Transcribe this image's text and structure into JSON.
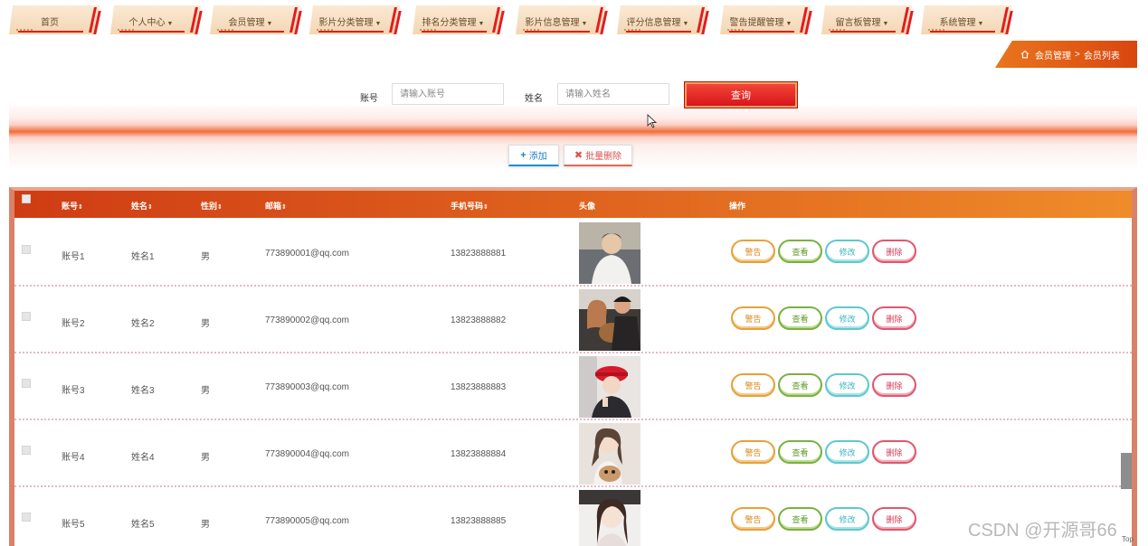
{
  "nav": [
    {
      "label": "首页",
      "dropdown": false
    },
    {
      "label": "个人中心",
      "dropdown": true
    },
    {
      "label": "会员管理",
      "dropdown": true
    },
    {
      "label": "影片分类管理",
      "dropdown": true
    },
    {
      "label": "排名分类管理",
      "dropdown": true
    },
    {
      "label": "影片信息管理",
      "dropdown": true
    },
    {
      "label": "评分信息管理",
      "dropdown": true
    },
    {
      "label": "警告提醒管理",
      "dropdown": true
    },
    {
      "label": "留言板管理",
      "dropdown": true
    },
    {
      "label": "系统管理",
      "dropdown": true
    }
  ],
  "breadcrumb": {
    "first": "会员管理",
    "separator": ">",
    "current": "会员列表"
  },
  "search": {
    "account_label": "账号",
    "account_placeholder": "请输入账号",
    "name_label": "姓名",
    "name_placeholder": "请输入姓名",
    "query_button": "查询"
  },
  "actions": {
    "add": "添加",
    "batch_delete": "批量删除"
  },
  "table": {
    "headers": {
      "account": "账号",
      "name": "姓名",
      "gender": "性别",
      "email": "邮箱",
      "phone": "手机号码",
      "avatar": "头像",
      "ops": "操作"
    },
    "rows": [
      {
        "account": "账号1",
        "name": "姓名1",
        "gender": "男",
        "email": "773890001@qq.com",
        "phone": "13823888881"
      },
      {
        "account": "账号2",
        "name": "姓名2",
        "gender": "男",
        "email": "773890002@qq.com",
        "phone": "13823888882"
      },
      {
        "account": "账号3",
        "name": "姓名3",
        "gender": "男",
        "email": "773890003@qq.com",
        "phone": "13823888883"
      },
      {
        "account": "账号4",
        "name": "姓名4",
        "gender": "男",
        "email": "773890004@qq.com",
        "phone": "13823888884"
      },
      {
        "account": "账号5",
        "name": "姓名5",
        "gender": "男",
        "email": "773890005@qq.com",
        "phone": "13823888885"
      }
    ],
    "row_actions": {
      "warn": "警告",
      "view": "查看",
      "edit": "修改",
      "delete": "删除"
    }
  },
  "watermark": "CSDN @开源哥66",
  "top_link": "Top",
  "colors": {
    "accent_red": "#e21d1d",
    "header_orange": "#e0661f",
    "query_red": "#d8101a"
  }
}
